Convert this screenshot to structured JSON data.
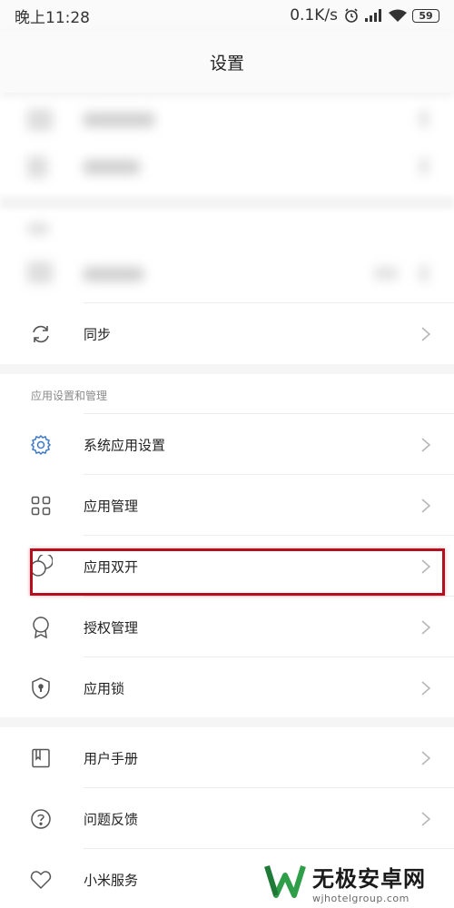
{
  "status_bar": {
    "time": "晚上11:28",
    "speed": "0.1K/s",
    "battery": "59"
  },
  "header": {
    "title": "设置"
  },
  "sync_row": {
    "label": "同步"
  },
  "section": {
    "header": "应用设置和管理"
  },
  "items": [
    {
      "label": "系统应用设置",
      "icon": "gear-icon"
    },
    {
      "label": "应用管理",
      "icon": "grid-icon"
    },
    {
      "label": "应用双开",
      "icon": "dual-circles-icon"
    },
    {
      "label": "授权管理",
      "icon": "badge-icon"
    },
    {
      "label": "应用锁",
      "icon": "shield-lock-icon"
    }
  ],
  "bottom_items": [
    {
      "label": "用户手册",
      "icon": "book-icon"
    },
    {
      "label": "问题反馈",
      "icon": "question-icon"
    },
    {
      "label": "小米服务",
      "icon": "heart-icon"
    }
  ],
  "watermark": {
    "title": "无极安卓网",
    "url": "wjhotelgroup.com"
  },
  "colors": {
    "highlight": "#b30f1f",
    "watermark_green": "#2e9e48"
  }
}
